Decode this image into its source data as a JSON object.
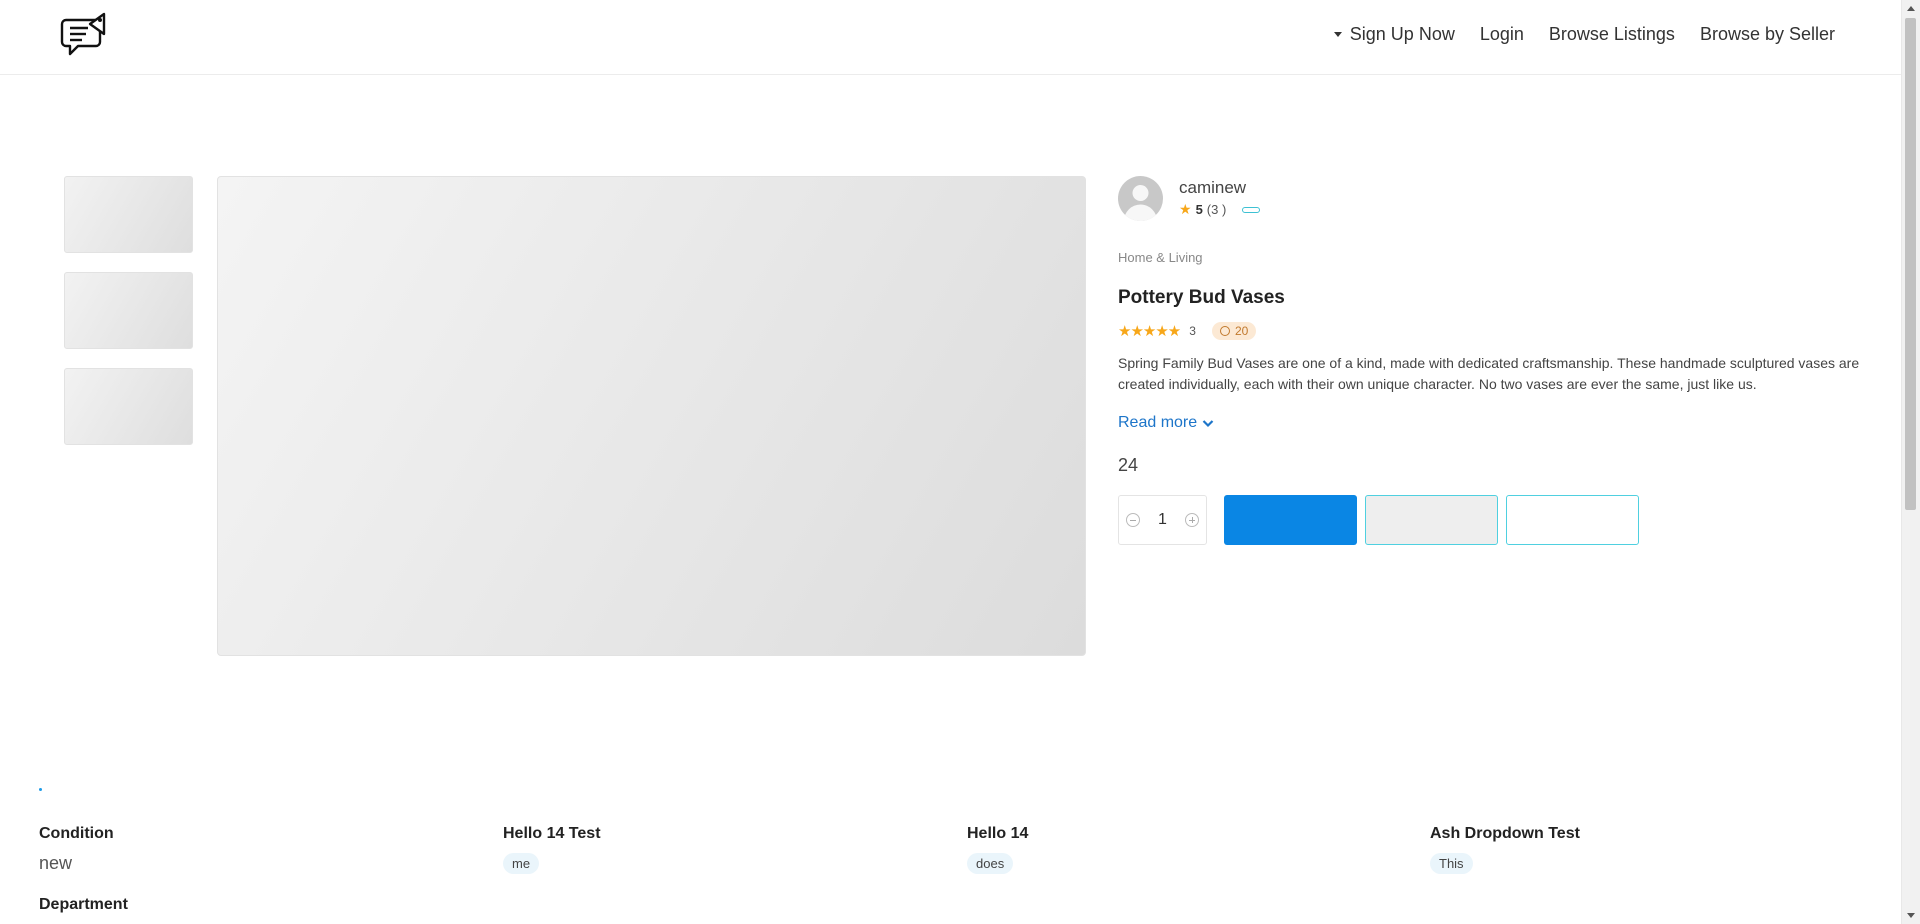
{
  "nav": {
    "sign_up": "Sign Up Now",
    "login": "Login",
    "browse_listings": "Browse Listings",
    "browse_by_seller": "Browse by Seller"
  },
  "seller": {
    "name": "caminew",
    "rating": "5",
    "reviews": "(3 )"
  },
  "product": {
    "category": "Home & Living",
    "title": "Pottery Bud Vases",
    "star_glyphs": "★★★★★",
    "rating_count": "3",
    "time_badge": "20",
    "description": "Spring Family Bud Vases are one of a kind, made with dedicated craftsmanship. These handmade sculptured vases are created individually, each with their own unique character. No two vases are ever the same, just like us.",
    "read_more": "Read more",
    "price": "24",
    "quantity": "1"
  },
  "attributes": [
    {
      "label": "Condition",
      "value": "new"
    },
    {
      "label": "Hello 14 Test",
      "value": "me"
    },
    {
      "label": "Hello 14",
      "value": "does"
    },
    {
      "label": "Ash Dropdown Test",
      "value": "This"
    },
    {
      "label": "Department",
      "value": ""
    }
  ],
  "colors": {
    "primary": "#0a86e4",
    "accent": "#4fd0e0",
    "star": "#f7a71a",
    "link": "#1d75c9"
  }
}
